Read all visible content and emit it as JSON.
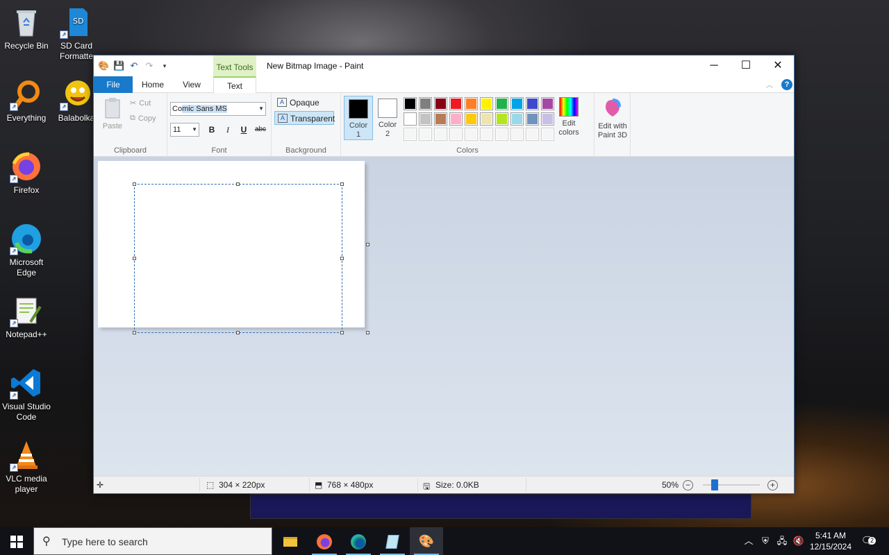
{
  "desktop": {
    "icons": [
      {
        "label": "Recycle Bin",
        "icon": "recycle-bin-icon"
      },
      {
        "label": "SD Card Formatte",
        "icon": "sd-card-icon"
      },
      {
        "label": "Everything",
        "icon": "everything-search-icon"
      },
      {
        "label": "Balabolka",
        "icon": "balabolka-icon"
      },
      {
        "label": "Firefox",
        "icon": "firefox-icon"
      },
      {
        "label": "Microsoft Edge",
        "icon": "edge-icon"
      },
      {
        "label": "Notepad++",
        "icon": "notepadpp-icon"
      },
      {
        "label": "Visual Studio Code",
        "icon": "vscode-icon"
      },
      {
        "label": "VLC media player",
        "icon": "vlc-icon"
      }
    ]
  },
  "window": {
    "title": "New Bitmap Image - Paint",
    "context_tab": "Text Tools",
    "tabs": [
      "File",
      "Home",
      "View",
      "Text"
    ],
    "active_tab": "Text"
  },
  "ribbon": {
    "clipboard": {
      "label": "Clipboard",
      "paste": "Paste",
      "cut": "Cut",
      "copy": "Copy"
    },
    "font": {
      "label": "Font",
      "family_prefix": "Co",
      "family_selected": "mic Sans MS",
      "size": "11",
      "bold": "B",
      "italic": "I",
      "underline": "U",
      "strike": "abc"
    },
    "background": {
      "label": "Background",
      "opaque": "Opaque",
      "transparent": "Transparent",
      "selected": "Transparent"
    },
    "colors": {
      "label": "Colors",
      "color1_label": "Color",
      "color1_num": "1",
      "color1": "#000000",
      "color2_label": "Color",
      "color2_num": "2",
      "color2": "#ffffff",
      "row1": [
        "#000000",
        "#7f7f7f",
        "#880015",
        "#ed1c24",
        "#ff7f27",
        "#fff200",
        "#22b14c",
        "#00a2e8",
        "#3f48cc",
        "#a349a4"
      ],
      "row2": [
        "#ffffff",
        "#c3c3c3",
        "#b97a57",
        "#ffaec9",
        "#ffc90e",
        "#efe4b0",
        "#b5e61d",
        "#99d9ea",
        "#7092be",
        "#c8bfe7"
      ],
      "row3": [
        "#f5f5f5",
        "#f5f5f5",
        "#f5f5f5",
        "#f5f5f5",
        "#f5f5f5",
        "#f5f5f5",
        "#f5f5f5",
        "#f5f5f5",
        "#f5f5f5",
        "#f5f5f5"
      ],
      "edit_line1": "Edit",
      "edit_line2": "colors"
    },
    "paint3d": {
      "line1": "Edit with",
      "line2": "Paint 3D"
    }
  },
  "status": {
    "selection_size": "304 × 220px",
    "image_size": "768 × 480px",
    "file_size": "Size: 0.0KB",
    "zoom": "50%",
    "zoom_level_percent": 50
  },
  "taskbar": {
    "search_placeholder": "Type here to search",
    "apps": [
      "file-explorer-icon",
      "firefox-icon",
      "edge-icon",
      "notepad-icon",
      "paint-icon"
    ],
    "time": "5:41 AM",
    "date": "12/15/2024",
    "notification_count": "2"
  }
}
